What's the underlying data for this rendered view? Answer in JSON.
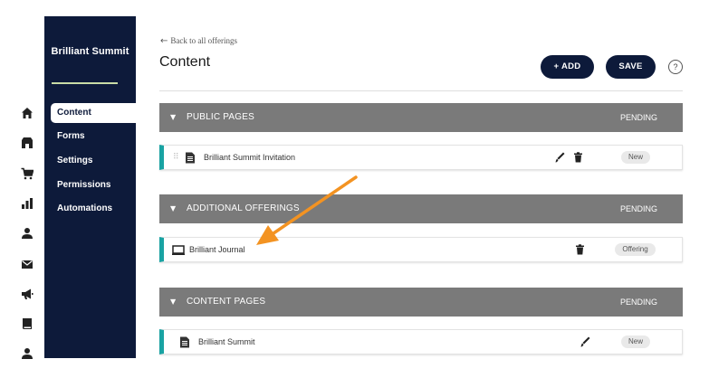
{
  "nav": {
    "title": "Brilliant Summit",
    "items": [
      {
        "label": "Content"
      },
      {
        "label": "Forms"
      },
      {
        "label": "Settings"
      },
      {
        "label": "Permissions"
      },
      {
        "label": "Automations"
      }
    ]
  },
  "rail": [
    "home-icon",
    "store-icon",
    "cart-icon",
    "bar-chart-icon",
    "person-icon",
    "mail-icon",
    "megaphone-icon",
    "book-icon",
    "people-icon"
  ],
  "header": {
    "back_label": "Back to all offerings",
    "title": "Content",
    "add_label": "+ ADD",
    "save_label": "SAVE",
    "help_label": "?"
  },
  "sections": [
    {
      "title": "PUBLIC PAGES",
      "status": "PENDING",
      "row": {
        "label": "Brilliant Summit Invitation",
        "badge": "New"
      }
    },
    {
      "title": "ADDITIONAL OFFERINGS",
      "status": "PENDING",
      "row": {
        "label": "Brilliant Journal",
        "badge": "Offering"
      }
    },
    {
      "title": "CONTENT PAGES",
      "status": "PENDING",
      "row": {
        "label": "Brilliant Summit",
        "badge": "New"
      }
    }
  ],
  "colors": {
    "nav_bg": "#0d1a3a",
    "accent_teal": "#19a3a3",
    "section_bg": "#7a7a7a",
    "annotation_arrow": "#f39322"
  }
}
